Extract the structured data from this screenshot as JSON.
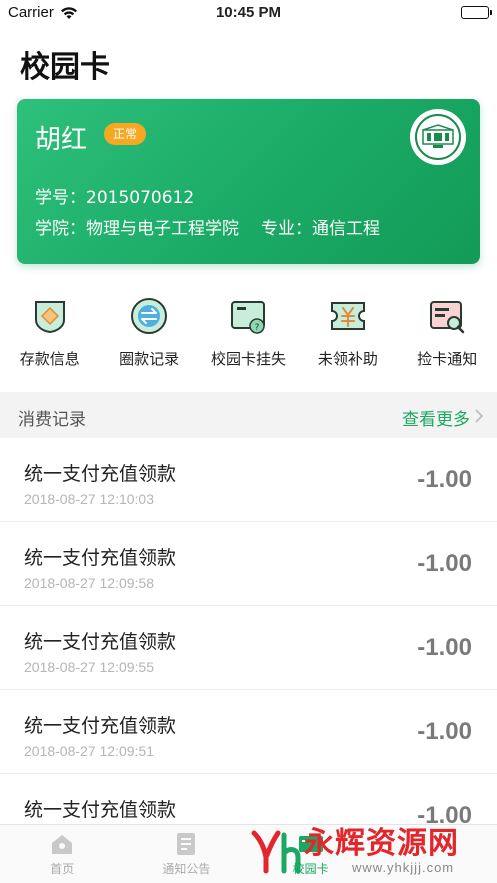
{
  "status_bar": {
    "carrier": "Carrier",
    "time": "10:45 PM"
  },
  "page": {
    "title": "校园卡"
  },
  "card": {
    "name": "胡红",
    "status": "正常",
    "student_id_label": "学号：",
    "student_id": "2015070612",
    "college_label": "学院：",
    "college": "物理与电子工程学院",
    "major_label": "专业：",
    "major": "通信工程"
  },
  "actions": [
    {
      "label": "存款信息",
      "icon": "deposit-icon"
    },
    {
      "label": "圈款记录",
      "icon": "transfer-icon"
    },
    {
      "label": "校园卡挂失",
      "icon": "card-loss-icon"
    },
    {
      "label": "未领补助",
      "icon": "subsidy-icon"
    },
    {
      "label": "捡卡通知",
      "icon": "found-card-icon"
    }
  ],
  "records_section": {
    "title": "消费记录",
    "more": "查看更多"
  },
  "records": [
    {
      "title": "统一支付充值领款",
      "time": "2018-08-27 12:10:03",
      "amount": "-1.00"
    },
    {
      "title": "统一支付充值领款",
      "time": "2018-08-27 12:09:58",
      "amount": "-1.00"
    },
    {
      "title": "统一支付充值领款",
      "time": "2018-08-27 12:09:55",
      "amount": "-1.00"
    },
    {
      "title": "统一支付充值领款",
      "time": "2018-08-27 12:09:51",
      "amount": "-1.00"
    },
    {
      "title": "统一支付充值领款",
      "time": "",
      "amount": "-1.00"
    }
  ],
  "tabbar": {
    "home": "首页",
    "notice": "通知公告",
    "card": "校园卡",
    "active": "card"
  },
  "watermark": {
    "text": "永辉资源网",
    "url": "www.yhkjjj.com"
  },
  "colors": {
    "accent": "#1aa862",
    "badge": "#f7a823",
    "amount": "#7a7a7a",
    "watermark": "#e3262c"
  }
}
